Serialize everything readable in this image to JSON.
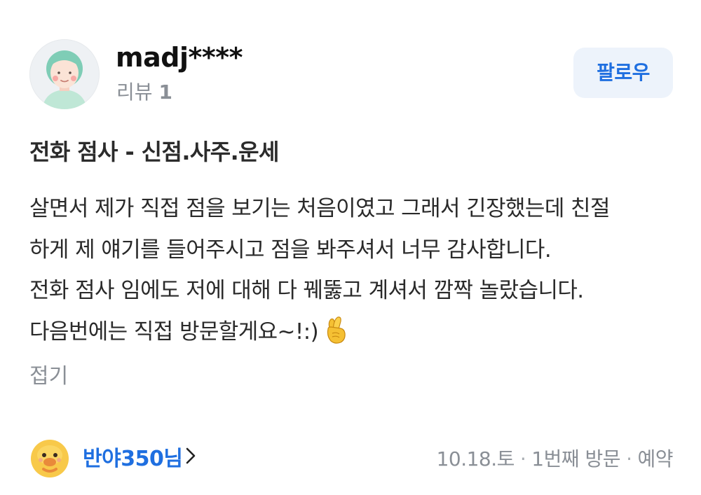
{
  "reviewer": {
    "username": "madj****",
    "review_label": "리뷰",
    "review_count": "1",
    "follow_label": "팔로우"
  },
  "product_title": "전화 점사 - 신점.사주.운세",
  "review_lines": [
    "살면서 제가 직접 점을 보기는 처음이였고 그래서 긴장했는데 친절",
    "하게 제 얘기를 들어주시고 점을 봐주셔서 너무 감사합니다.",
    "전화 점사 임에도 저에 대해 다 꿰뚫고 계셔서 깜짝 놀랐습니다.",
    "다음번에는 직접 방문할게요~!:)"
  ],
  "review_emoji": "crossed-fingers-icon",
  "fold_label": "접기",
  "owner": {
    "name": "반야350님",
    "avatar_icon": "duck-mascot-icon"
  },
  "meta": {
    "date": "10.18.토",
    "visit": "1번째 방문",
    "type": "예약"
  },
  "colors": {
    "accent": "#1f6fe0",
    "follow_bg": "#edf3fb",
    "muted": "#8a8f96",
    "text": "#2a2a2a"
  }
}
